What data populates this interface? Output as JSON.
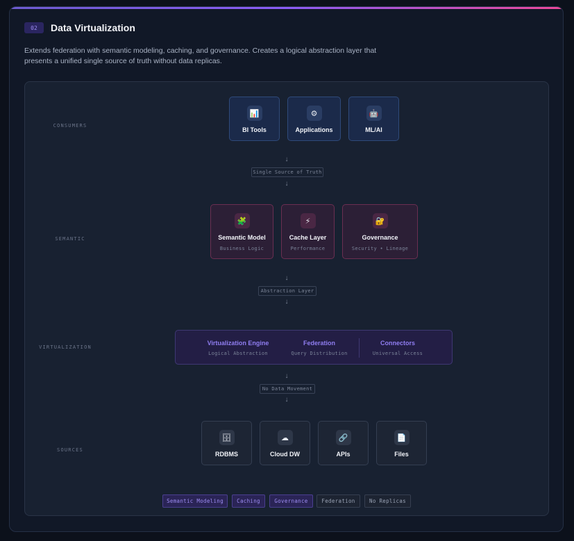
{
  "header": {
    "badge": "02",
    "title": "Data Virtualization",
    "description": "Extends federation with semantic modeling, caching, and governance. Creates a logical abstraction layer that presents a unified single source of truth without data replicas."
  },
  "layers": {
    "consumers": "CONSUMERS",
    "semantic": "SEMANTIC",
    "virtualization": "VIRTUALIZATION",
    "sources": "SOURCES"
  },
  "consumers": [
    {
      "label": "BI Tools",
      "icon": "bar-chart-icon",
      "glyph": "📊"
    },
    {
      "label": "Applications",
      "icon": "gear-icon",
      "glyph": "⚙"
    },
    {
      "label": "ML/AI",
      "icon": "robot-icon",
      "glyph": "🤖"
    }
  ],
  "semantic": [
    {
      "label": "Semantic Model",
      "sub": "Business Logic",
      "icon": "puzzle-icon",
      "glyph": "🧩"
    },
    {
      "label": "Cache Layer",
      "sub": "Performance",
      "icon": "lightning-icon",
      "glyph": "⚡"
    },
    {
      "label": "Governance",
      "sub": "Security • Lineage",
      "icon": "lock-icon",
      "glyph": "🔐"
    }
  ],
  "virtualization": [
    {
      "title": "Virtualization Engine",
      "sub": "Logical Abstraction"
    },
    {
      "title": "Federation",
      "sub": "Query Distribution"
    },
    {
      "title": "Connectors",
      "sub": "Universal Access"
    }
  ],
  "sources": [
    {
      "label": "RDBMS",
      "icon": "database-icon",
      "glyph": "🗄"
    },
    {
      "label": "Cloud DW",
      "icon": "cloud-icon",
      "glyph": "☁"
    },
    {
      "label": "APIs",
      "icon": "link-icon",
      "glyph": "🔗"
    },
    {
      "label": "Files",
      "icon": "file-icon",
      "glyph": "📄"
    }
  ],
  "connectors": {
    "arrow": "↓",
    "c1": "Single Source of Truth",
    "c2": "Abstraction Layer",
    "c3": "No Data Movement"
  },
  "tags": [
    "Semantic Modeling",
    "Caching",
    "Governance",
    "Federation",
    "No Replicas"
  ],
  "colors": {
    "accent": "#8f7df0",
    "consumer_border": "#2f4a7a",
    "semantic_border": "#6b2f51",
    "gradient_end": "#ec4899"
  }
}
